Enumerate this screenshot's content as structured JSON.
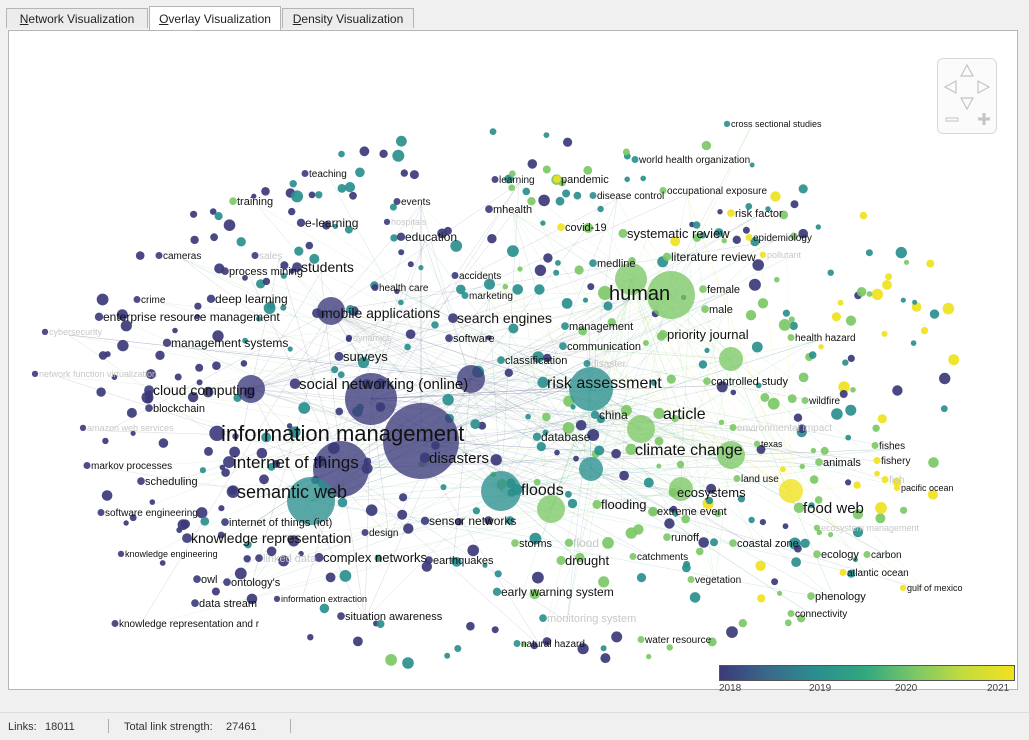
{
  "tabs": [
    {
      "accel": "N",
      "rest": "etwork Visualization",
      "active": false
    },
    {
      "accel": "O",
      "rest": "verlay Visualization",
      "active": true
    },
    {
      "accel": "D",
      "rest": "ensity Visualization",
      "active": false
    }
  ],
  "legend": {
    "ticks": [
      "2018",
      "2019",
      "2020",
      "2021"
    ],
    "colors": [
      "#3b3a7a",
      "#2a8f8e",
      "#7cc867",
      "#f0e21e"
    ]
  },
  "status": {
    "links_label": "Links:",
    "links_value": "18011",
    "strength_label": "Total link strength:",
    "strength_value": "27461"
  },
  "labels": [
    "cross sectional studies",
    "world health organization",
    "disease control",
    "occupational exposure",
    "teaching",
    "learning",
    "pandemic",
    "training",
    "events",
    "mhealth",
    "e-learning",
    "hospitals",
    "covid-19",
    "risk factor",
    "education",
    "systematic review",
    "epidemiology",
    "cameras",
    "sales",
    "process mining",
    "students",
    "accidents",
    "medline",
    "literature review",
    "pollutant",
    "human",
    "female",
    "crime",
    "deep learning",
    "health care",
    "marketing",
    "male",
    "enterprise resource management",
    "mobile applications",
    "search engines",
    "management",
    "cybersecurity",
    "priority journal",
    "health hazard",
    "management systems",
    "dynamics",
    "software",
    "communication",
    "surveys",
    "classification",
    "disaster",
    "network function virtualization",
    "social networking (online)",
    "risk assessment",
    "controlled study",
    "cloud computing",
    "wildfire",
    "blockchain",
    "china",
    "article",
    "amazon web services",
    "information management",
    "database",
    "environmental impact",
    "texas",
    "fishes",
    "climate change",
    "internet of things",
    "disasters",
    "animals",
    "fishery",
    "markov processes",
    "scheduling",
    "land use",
    "fish",
    "pacific ocean",
    "floods",
    "ecosystems",
    "semantic web",
    "flooding",
    "food web",
    "software engineering",
    "internet of things (iot)",
    "sensor networks",
    "extreme event",
    "ecosystem management",
    "design",
    "runoff",
    "knowledge representation",
    "storms",
    "flood",
    "coastal zone",
    "knowledge engineering",
    "linked data",
    "complex networks",
    "earthquakes",
    "drought",
    "catchments",
    "ecology",
    "carbon",
    "atlantic ocean",
    "owl",
    "ontology's",
    "vegetation",
    "gulf of mexico",
    "early warning system",
    "phenology",
    "data stream",
    "information extraction",
    "connectivity",
    "situation awareness",
    "monitoring system",
    "knowledge representation and r",
    "natural hazard",
    "water resource"
  ]
}
